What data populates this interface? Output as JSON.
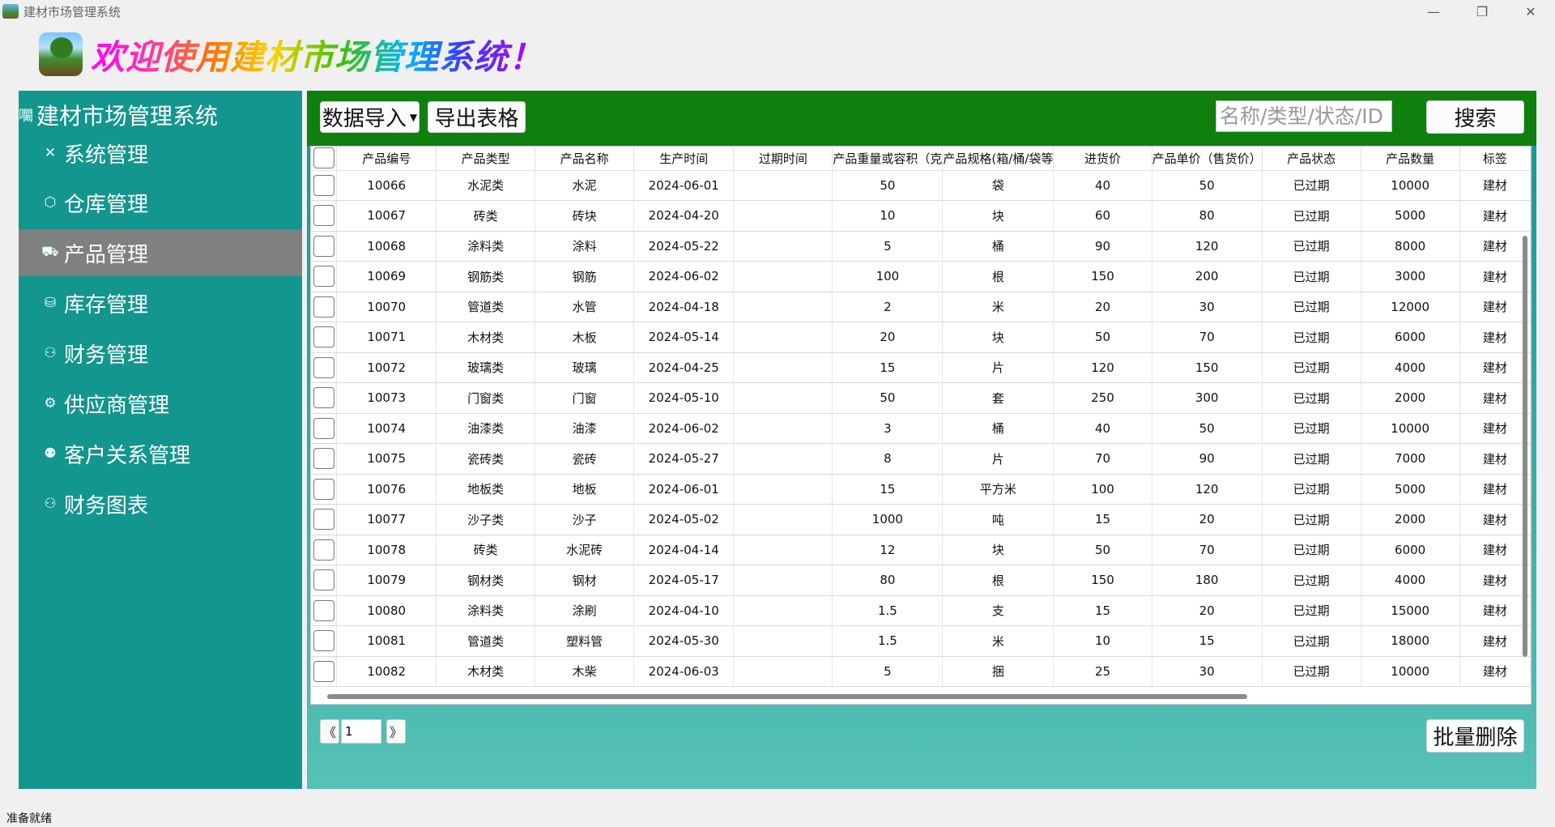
{
  "window": {
    "title": "建材市场管理系统"
  },
  "banner": {
    "welcome_text": "欢迎使用建材市场管理系统！"
  },
  "sidebar": {
    "brand_icon": "㘚",
    "brand_text": "建材市场管理系统",
    "items": [
      {
        "label": "系统管理",
        "icon": "✕",
        "icon_name": "tools-icon",
        "active": false
      },
      {
        "label": "仓库管理",
        "icon": "⬡",
        "icon_name": "box-icon",
        "active": false
      },
      {
        "label": "产品管理",
        "icon": "⛟",
        "icon_name": "cart-icon",
        "active": true
      },
      {
        "label": "库存管理",
        "icon": "⛁",
        "icon_name": "stock-icon",
        "active": false
      },
      {
        "label": "财务管理",
        "icon": "⚇",
        "icon_name": "finance-icon",
        "active": false
      },
      {
        "label": "供应商管理",
        "icon": "⚙",
        "icon_name": "supplier-icon",
        "active": false
      },
      {
        "label": "客户关系管理",
        "icon": "⚉",
        "icon_name": "customers-icon",
        "active": false
      },
      {
        "label": "财务图表",
        "icon": "⚇",
        "icon_name": "chart-icon",
        "active": false
      }
    ]
  },
  "toolbar": {
    "import_label": "数据导入",
    "export_label": "导出表格",
    "search_placeholder": "名称/类型/状态/ID",
    "search_label": "搜索"
  },
  "table": {
    "columns": [
      "产品编号",
      "产品类型",
      "产品名称",
      "生产时间",
      "过期时间",
      "产品重量或容积（克",
      "产品规格(箱/桶/袋等",
      "进货价",
      "产品单价（售货价）",
      "产品状态",
      "产品数量",
      "标签"
    ],
    "rows": [
      [
        "10066",
        "水泥类",
        "水泥",
        "2024-06-01",
        "",
        "50",
        "袋",
        "40",
        "50",
        "已过期",
        "10000",
        "建材"
      ],
      [
        "10067",
        "砖类",
        "砖块",
        "2024-04-20",
        "",
        "10",
        "块",
        "60",
        "80",
        "已过期",
        "5000",
        "建材"
      ],
      [
        "10068",
        "涂料类",
        "涂料",
        "2024-05-22",
        "",
        "5",
        "桶",
        "90",
        "120",
        "已过期",
        "8000",
        "建材"
      ],
      [
        "10069",
        "钢筋类",
        "钢筋",
        "2024-06-02",
        "",
        "100",
        "根",
        "150",
        "200",
        "已过期",
        "3000",
        "建材"
      ],
      [
        "10070",
        "管道类",
        "水管",
        "2024-04-18",
        "",
        "2",
        "米",
        "20",
        "30",
        "已过期",
        "12000",
        "建材"
      ],
      [
        "10071",
        "木材类",
        "木板",
        "2024-05-14",
        "",
        "20",
        "块",
        "50",
        "70",
        "已过期",
        "6000",
        "建材"
      ],
      [
        "10072",
        "玻璃类",
        "玻璃",
        "2024-04-25",
        "",
        "15",
        "片",
        "120",
        "150",
        "已过期",
        "4000",
        "建材"
      ],
      [
        "10073",
        "门窗类",
        "门窗",
        "2024-05-10",
        "",
        "50",
        "套",
        "250",
        "300",
        "已过期",
        "2000",
        "建材"
      ],
      [
        "10074",
        "油漆类",
        "油漆",
        "2024-06-02",
        "",
        "3",
        "桶",
        "40",
        "50",
        "已过期",
        "10000",
        "建材"
      ],
      [
        "10075",
        "瓷砖类",
        "瓷砖",
        "2024-05-27",
        "",
        "8",
        "片",
        "70",
        "90",
        "已过期",
        "7000",
        "建材"
      ],
      [
        "10076",
        "地板类",
        "地板",
        "2024-06-01",
        "",
        "15",
        "平方米",
        "100",
        "120",
        "已过期",
        "5000",
        "建材"
      ],
      [
        "10077",
        "沙子类",
        "沙子",
        "2024-05-02",
        "",
        "1000",
        "吨",
        "15",
        "20",
        "已过期",
        "2000",
        "建材"
      ],
      [
        "10078",
        "砖类",
        "水泥砖",
        "2024-04-14",
        "",
        "12",
        "块",
        "50",
        "70",
        "已过期",
        "6000",
        "建材"
      ],
      [
        "10079",
        "钢材类",
        "钢材",
        "2024-05-17",
        "",
        "80",
        "根",
        "150",
        "180",
        "已过期",
        "4000",
        "建材"
      ],
      [
        "10080",
        "涂料类",
        "涂刷",
        "2024-04-10",
        "",
        "1.5",
        "支",
        "15",
        "20",
        "已过期",
        "15000",
        "建材"
      ],
      [
        "10081",
        "管道类",
        "塑料管",
        "2024-05-30",
        "",
        "1.5",
        "米",
        "10",
        "15",
        "已过期",
        "18000",
        "建材"
      ],
      [
        "10082",
        "木材类",
        "木柴",
        "2024-06-03",
        "",
        "5",
        "捆",
        "25",
        "30",
        "已过期",
        "10000",
        "建材"
      ]
    ]
  },
  "pager": {
    "prev": "《",
    "page": "1",
    "next": "》"
  },
  "batch_delete_label": "批量删除",
  "status": {
    "text": "准备就绪"
  },
  "colors": {
    "sidebar": "#13968e",
    "toolbar": "#0f7f0f",
    "active_nav": "#808080"
  }
}
